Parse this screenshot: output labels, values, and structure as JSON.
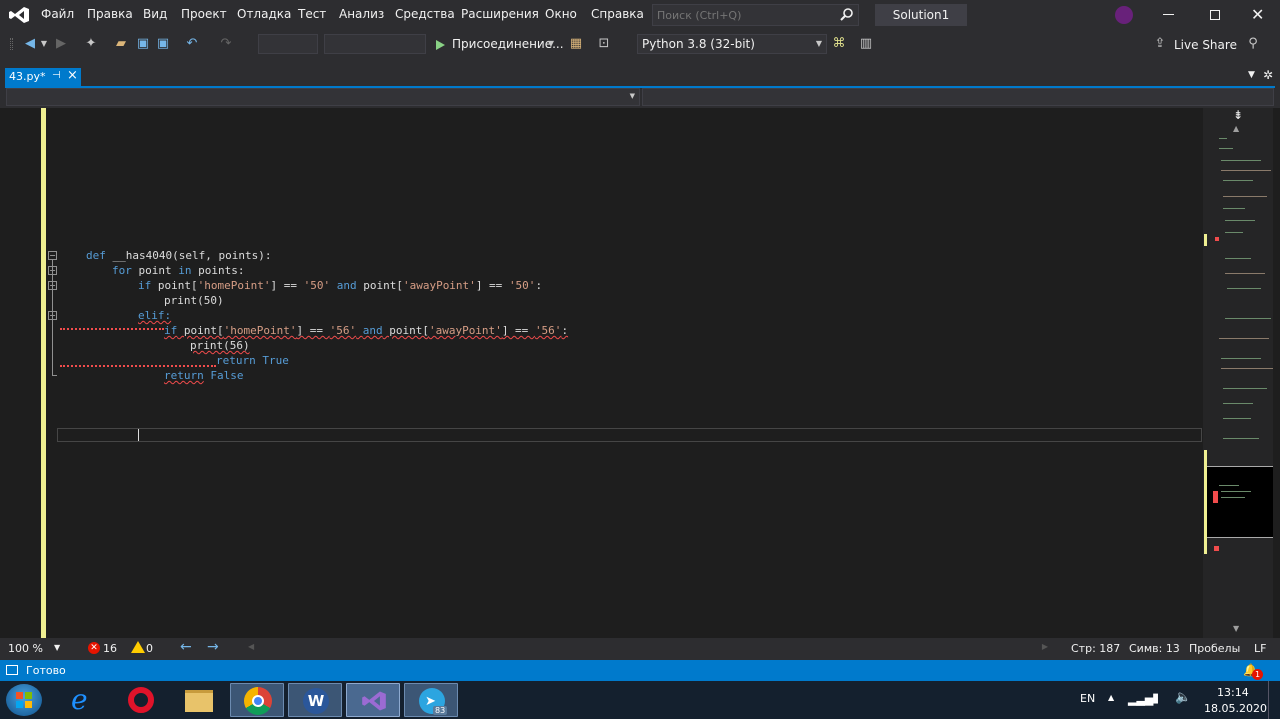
{
  "menu": [
    "Файл",
    "Правка",
    "Вид",
    "Проект",
    "Отладка",
    "Тест",
    "Анализ",
    "Средства",
    "Расширения",
    "Окно",
    "Справка"
  ],
  "search": {
    "placeholder": "Поиск (Ctrl+Q)"
  },
  "solution_name": "Solution1",
  "toolbar": {
    "attach_label": "Присоединение...",
    "python_env": "Python 3.8 (32-bit)",
    "live_share": "Live Share"
  },
  "tab": {
    "name": "43.py*",
    "pin": "⊣",
    "close": "×"
  },
  "code": {
    "line1": {
      "def": "def",
      "rest": " __has4040(self, points):"
    },
    "line2": {
      "for": "for",
      "a": " point ",
      "in": "in",
      "b": " points:"
    },
    "line3": {
      "if": "if",
      "a": " point[",
      "s1": "'homePoint'",
      "b": "] == ",
      "s2": "'50'",
      "c": " ",
      "and": "and",
      "d": " point[",
      "s3": "'awayPoint'",
      "e": "] == ",
      "s4": "'50'",
      "f": ":"
    },
    "line4": "print(50)",
    "line5": "elif:",
    "line6": {
      "if": "if",
      "a": " point[",
      "s1": "'homePoint'",
      "b": "] == ",
      "s2": "'56'",
      "c": " ",
      "and": "and",
      "d": " point[",
      "s3": "'awayPoint'",
      "e": "] == ",
      "s4": "'56'",
      "f": ":"
    },
    "line7": "print(56)",
    "line8": {
      "return": "return",
      "val": "True"
    },
    "line9": {
      "return": "return",
      "val": "False"
    }
  },
  "status_strip": {
    "zoom": "100 %",
    "errors": "16",
    "warnings": "0",
    "line": "Стр: 187",
    "col": "Симв: 13",
    "whitespace": "Пробелы",
    "eol": "LF"
  },
  "statusbar": {
    "ready": "Готово",
    "notifications": "1"
  },
  "taskbar": {
    "lang": "EN",
    "time": "13:14",
    "date": "18.05.2020",
    "telegram_badge": "83"
  },
  "colors": {
    "accent": "#007acc",
    "background": "#1e1e1e",
    "chrome": "#2d2d30",
    "keyword": "#569cd6",
    "string": "#d69d85",
    "error": "#f14c4c"
  }
}
